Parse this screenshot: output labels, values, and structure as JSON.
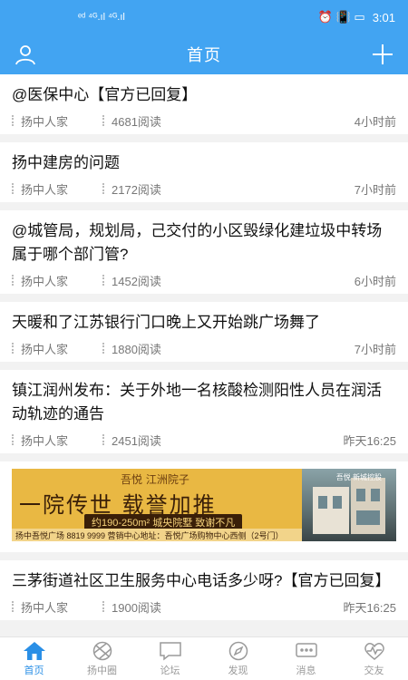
{
  "status_bar": {
    "left_text": "ᵉᵈ ⁴ᴳ.ıl ⁴ᴳ.ıl",
    "right_icons": "⏰ 📳 ▭",
    "time": "3:01"
  },
  "header": {
    "title": "首页",
    "left_icon": "user-icon",
    "right_icon": "plus-icon"
  },
  "feed": [
    {
      "title": "@医保中心【官方已回复】",
      "source": "扬中人家",
      "reads": "4681阅读",
      "time": "4小时前"
    },
    {
      "title": "扬中建房的问题",
      "source": "扬中人家",
      "reads": "2172阅读",
      "time": "7小时前"
    },
    {
      "title": "@城管局，规划局，己交付的小区毁绿化建垃圾中转场属于哪个部门管?",
      "source": "扬中人家",
      "reads": "1452阅读",
      "time": "6小时前"
    },
    {
      "title": "天暖和了江苏银行门口晚上又开始跳广场舞了",
      "source": "扬中人家",
      "reads": "1880阅读",
      "time": "7小时前"
    },
    {
      "title": "镇江润州发布：关于外地一名核酸检测阳性人员在润活动轨迹的通告",
      "source": "扬中人家",
      "reads": "2451阅读",
      "time": "昨天16:25"
    }
  ],
  "ad": {
    "top_text": "吾悦 江洲院子",
    "main_text": "一院传世 载誉加推",
    "price_text": "约190-250m² 城央院墅 致谢不凡",
    "bottom_text": "扬中吾悦广场  8819 9999  营销中心地址：吾悦广场购物中心西侧（2号门）",
    "logo_text": "吾悦 新城控股"
  },
  "feed2": [
    {
      "title": "三茅街道社区卫生服务中心电话多少呀?【官方已回复】",
      "source": "扬中人家",
      "reads": "1900阅读",
      "time": "昨天16:25"
    }
  ],
  "tabs": [
    {
      "label": "首页",
      "icon": "home-icon",
      "active": true
    },
    {
      "label": "扬中圈",
      "icon": "circle-icon",
      "active": false
    },
    {
      "label": "论坛",
      "icon": "chat-icon",
      "active": false
    },
    {
      "label": "发现",
      "icon": "compass-icon",
      "active": false
    },
    {
      "label": "消息",
      "icon": "message-icon",
      "active": false
    },
    {
      "label": "交友",
      "icon": "heartbeat-icon",
      "active": false
    }
  ],
  "colors": {
    "header_bg": "#42a4f2",
    "active_tab": "#2a8fe6"
  }
}
